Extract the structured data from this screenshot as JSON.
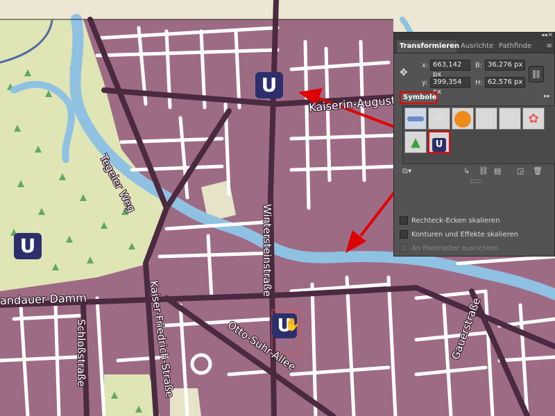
{
  "map": {
    "streets": {
      "kaiserin": "Kaiserin-Augusta",
      "tegeler": "Tegeler Weg",
      "winterstein": "Wintersteinstraße",
      "landauer": "andauer Damm",
      "schloss": "Schloßstraße",
      "kaiser_friedrich": "Kaiser-Friedrich-Straße",
      "otto_suhr": "Otto-Suhr-Allee",
      "gauer": "Gauerstraße"
    },
    "symbol_letter": "U",
    "colors": {
      "urban": "#9e6b85",
      "road": "#ffffff",
      "major_road": "#4a2a40",
      "water": "#8fc1e3",
      "park": "#dfe5b4",
      "u_bahn": "#2c2f6b",
      "annotation": "#e00000"
    }
  },
  "panel": {
    "tabs": [
      {
        "label": "Transformieren",
        "active": true
      },
      {
        "label": "Ausrichte",
        "active": false
      },
      {
        "label": "Pathfinde",
        "active": false
      }
    ],
    "transform": {
      "x_label": "x:",
      "x_value": "663,142 px",
      "b_label": "B:",
      "b_value": "36,276 px",
      "y_label": "y:",
      "y_value": "399,354 px",
      "h_label": "H:",
      "h_value": "62,576 px"
    },
    "symbols_tab": "Symbole",
    "symbols": [
      "brush-stroke",
      "splatter",
      "orange-button",
      "dashed-line",
      "dotted-ring",
      "flower",
      "tree",
      "u-bahn"
    ],
    "symbol_u_letter": "U",
    "checkboxes": [
      {
        "label": "Rechteck-Ecken skalieren",
        "disabled": false
      },
      {
        "label": "Konturen und Effekte skalieren",
        "disabled": false
      },
      {
        "label": "An Pixelraster ausrichten",
        "disabled": true
      }
    ]
  }
}
